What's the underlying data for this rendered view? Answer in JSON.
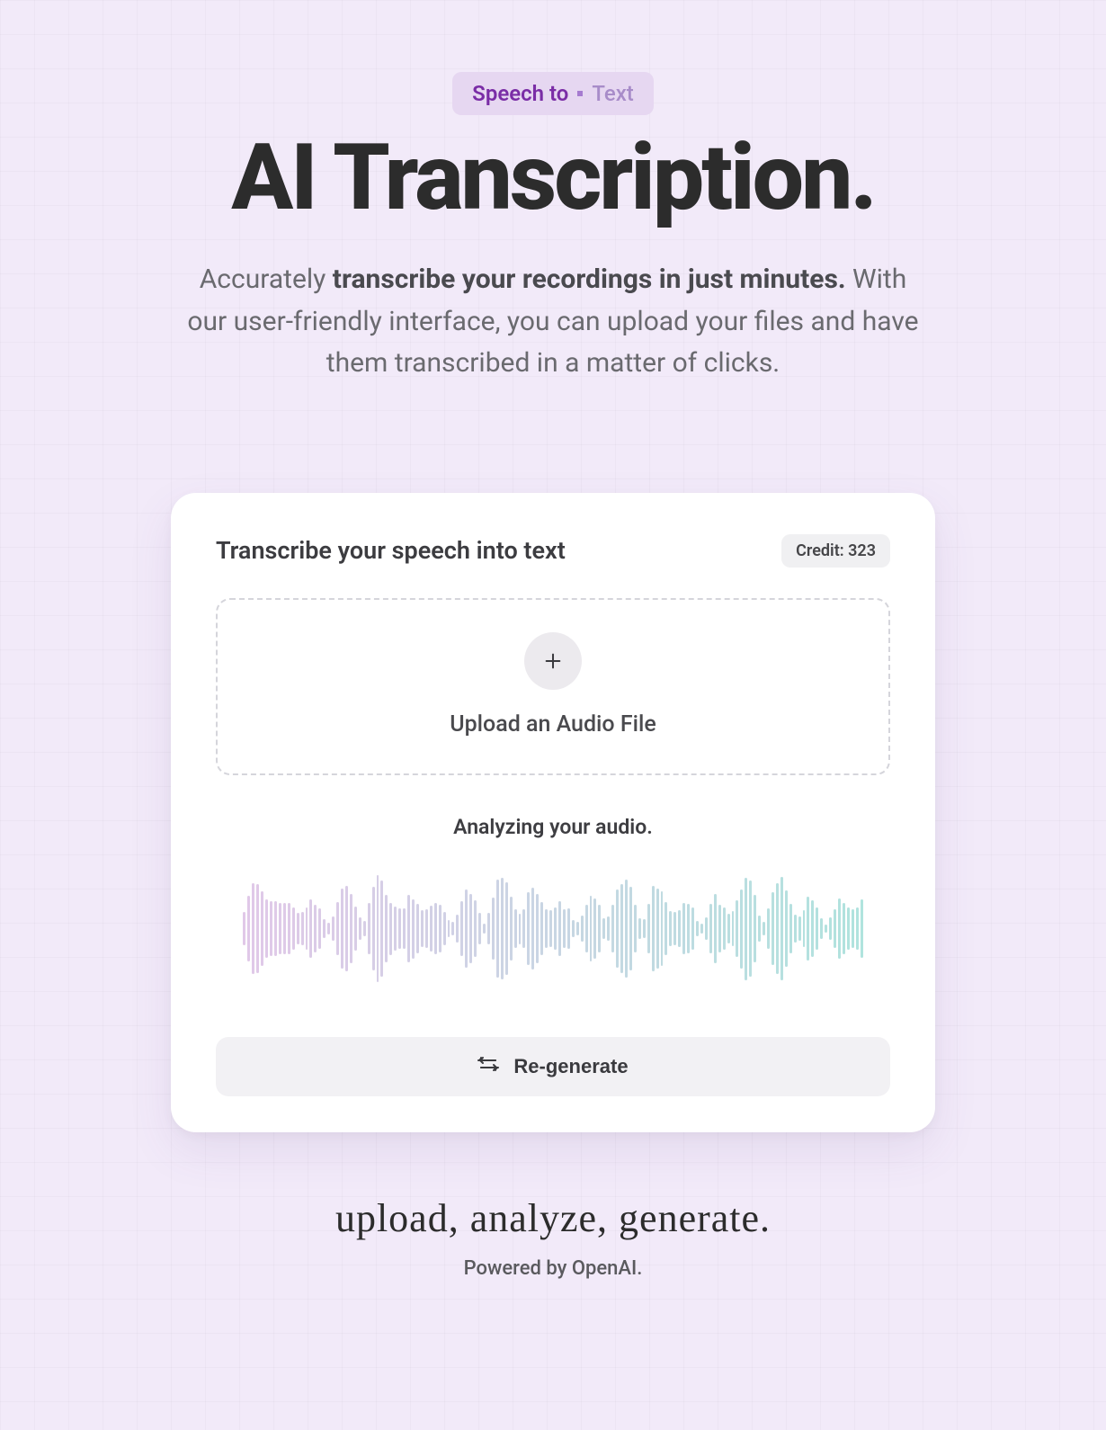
{
  "hero": {
    "badge_left": "Speech to",
    "badge_right": "Text",
    "title": "AI Transcription.",
    "subtitle_lead": "Accurately ",
    "subtitle_strong": "transcribe your recordings in just minutes.",
    "subtitle_tail": " With our user-friendly interface, you can upload your files and have them transcribed in a matter of clicks."
  },
  "card": {
    "title": "Transcribe your speech into text",
    "credit_label": "Credit: 323",
    "upload_label": "Upload an Audio File",
    "status_text": "Analyzing your audio.",
    "regenerate_label": "Re-generate"
  },
  "footer": {
    "tagline": "upload, analyze, generate.",
    "powered": "Powered by OpenAI."
  },
  "colors": {
    "accent_purple": "#7a2da6",
    "badge_bg": "#e6d7f1",
    "wave_a": "#c89bd6",
    "wave_b": "#8fd0d4"
  }
}
